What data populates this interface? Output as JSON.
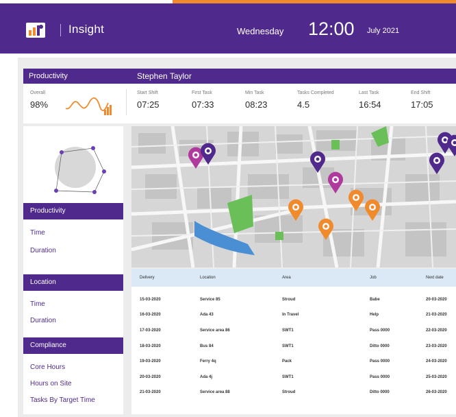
{
  "header": {
    "app_title": "Insight",
    "day": "Wednesday",
    "time": "12:00",
    "month": "July 2021",
    "brand_color": "#4f2a8c",
    "accent_color": "#f18a2c"
  },
  "productivity": {
    "title": "Productivity",
    "employee": "Stephen Taylor",
    "overall_label": "Overall",
    "overall_value": "98%",
    "metrics": [
      {
        "label": "Start Shift",
        "value": "07:25"
      },
      {
        "label": "First Task",
        "value": "07:33"
      },
      {
        "label": "Min Task",
        "value": "08:23"
      },
      {
        "label": "Tasks Completed",
        "value": "4.5"
      },
      {
        "label": "Last Task",
        "value": "16:54"
      },
      {
        "label": "End Shift",
        "value": "17:05"
      }
    ]
  },
  "sidebar": {
    "sections": [
      {
        "title": "Productivity",
        "items": [
          "Time",
          "Duration"
        ]
      },
      {
        "title": "Location",
        "items": [
          "Time",
          "Duration"
        ]
      },
      {
        "title": "Compliance",
        "items": [
          "Core Hours",
          "Hours on Site",
          "Tasks By Target Time"
        ]
      }
    ]
  },
  "map": {
    "pin_colors": {
      "purple": "#4f2a8c",
      "magenta": "#b0399e",
      "orange": "#f18a2c"
    },
    "pins": [
      {
        "color": "magenta"
      },
      {
        "color": "purple"
      },
      {
        "color": "purple"
      },
      {
        "color": "magenta"
      },
      {
        "color": "orange"
      },
      {
        "color": "orange"
      },
      {
        "color": "orange"
      },
      {
        "color": "orange"
      },
      {
        "color": "purple"
      },
      {
        "color": "purple"
      },
      {
        "color": "purple"
      }
    ]
  },
  "table": {
    "columns": [
      "Delivery",
      "Location",
      "Area",
      "Job",
      "Next date"
    ],
    "rows": [
      [
        "15-03-2020",
        "Service 85",
        "Stroud",
        "Babe",
        "20-03-2020"
      ],
      [
        "16-03-2020",
        "Ada 43",
        "In Travel",
        "Help",
        "21-03-2020"
      ],
      [
        "17-03-2020",
        "Service area 86",
        "SWT1",
        "Pass 0000",
        "22-03-2020"
      ],
      [
        "18-03-2020",
        "Bus 84",
        "SWT1",
        "Ditto 0000",
        "23-03-2020"
      ],
      [
        "19-03-2020",
        "Ferry 4q",
        "Pack",
        "Pass 0000",
        "24-03-2020"
      ],
      [
        "20-03-2020",
        "Ada 4j",
        "SWT1",
        "Pass 0000",
        "25-03-2020"
      ],
      [
        "21-03-2020",
        "Service area 88",
        "Stroud",
        "Ditto 0000",
        "26-03-2020"
      ]
    ]
  }
}
